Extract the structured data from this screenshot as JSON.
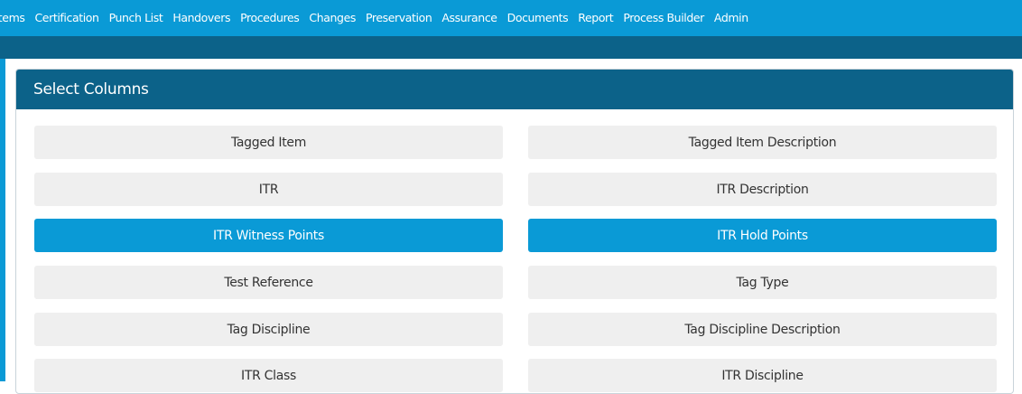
{
  "nav": {
    "items": [
      "Items",
      "Certification",
      "Punch List",
      "Handovers",
      "Procedures",
      "Changes",
      "Preservation",
      "Assurance",
      "Documents",
      "Report",
      "Process Builder",
      "Admin"
    ]
  },
  "panel": {
    "title": "Select Columns",
    "columns": [
      {
        "label": "Tagged Item",
        "selected": false
      },
      {
        "label": "Tagged Item Description",
        "selected": false
      },
      {
        "label": "ITR",
        "selected": false
      },
      {
        "label": "ITR Description",
        "selected": false
      },
      {
        "label": "ITR Witness Points",
        "selected": true
      },
      {
        "label": "ITR Hold Points",
        "selected": true
      },
      {
        "label": "Test Reference",
        "selected": false
      },
      {
        "label": "Tag Type",
        "selected": false
      },
      {
        "label": "Tag Discipline",
        "selected": false
      },
      {
        "label": "Tag Discipline Description",
        "selected": false
      },
      {
        "label": "ITR Class",
        "selected": false
      },
      {
        "label": "ITR Discipline",
        "selected": false
      }
    ]
  },
  "colors": {
    "nav_bg": "#0a9ad6",
    "header_bg": "#0c6289",
    "button_bg": "#efefef",
    "button_selected_bg": "#0a9ad6"
  }
}
